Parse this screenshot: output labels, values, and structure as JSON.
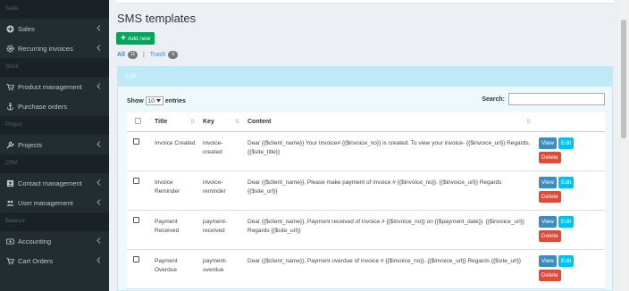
{
  "sidebar": {
    "sections": {
      "sales": "Sales",
      "stock": "Stock",
      "project": "Project",
      "crm": "CRM",
      "balance": "Balance"
    },
    "items": {
      "sales": "Sales",
      "recurring": "Recurring invoices",
      "product": "Product management",
      "purchase": "Purchase orders",
      "projects": "Projects",
      "contact": "Contact management",
      "user": "User management",
      "accounting": "Accounting",
      "cart": "Cart Orders"
    }
  },
  "page": {
    "title": "SMS templates",
    "add_button": "Add new",
    "filter_all": "All",
    "filter_all_count": "11",
    "filter_sep": "|",
    "filter_trash": "Trash",
    "filter_trash_count": "0"
  },
  "box": {
    "title": "List",
    "show_label": "Show",
    "show_value": "10",
    "entries_label": "entries",
    "search_label": "Search:"
  },
  "table": {
    "headers": {
      "title": "Title",
      "key": "Key",
      "content": "Content"
    },
    "rows": [
      {
        "title": "Invoice Created",
        "key": "invoice-created",
        "content": "Dear {{$client_name}} Your Invoice# {{$invoice_no}} is created. To view your invoice- {{$invoice_url}} Regards, {{$site_title}}"
      },
      {
        "title": "Invoice Reminder",
        "key": "invoice-reminder",
        "content": "Dear {{$client_name}}, Please make payment of invoice # {{$invoice_no}}. {{$invoice_url}} Regards {{$site_url}}"
      },
      {
        "title": "Payment Received",
        "key": "payment-received",
        "content": "Dear {{$client_name}}, Payment received of invoice # {{$invoice_no}} on {{$payment_date}}. {{$invoice_url}} Regards {{$site_url}}"
      },
      {
        "title": "Payment Overdue",
        "key": "payment-overdue",
        "content": "Dear {{$client_name}}, Payment overdue of invoice # {{$invoice_no}}. {{$invoice_url}} Regards {{$site_url}}"
      }
    ],
    "actions": {
      "view": "View",
      "edit": "Edit",
      "delete": "Delete"
    }
  },
  "colors": {
    "sidebar_bg": "#222d32",
    "add_button": "#00a65a",
    "view_button": "#3c8dbc",
    "edit_button": "#00c0ef",
    "delete_button": "#dd4b39",
    "box_header": "#bfe9f7"
  }
}
